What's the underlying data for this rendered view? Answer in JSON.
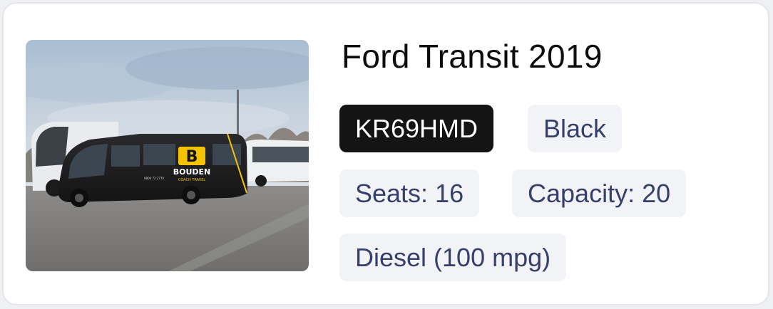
{
  "vehicle": {
    "title": "Ford Transit 2019",
    "registration": "KR69HMD",
    "colour": "Black",
    "seats": "Seats: 16",
    "capacity": "Capacity: 20",
    "fuel": "Diesel (100 mpg)",
    "photo": {
      "livery_brand": "BOUDEN",
      "livery_sub": "COACH TRAVEL",
      "livery_phone": "0800 72 2770"
    }
  },
  "colors": {
    "registration_bg": "#141414",
    "chip_bg": "#f1f3f6",
    "chip_text": "#37406a",
    "brand_yellow": "#f5c400"
  }
}
